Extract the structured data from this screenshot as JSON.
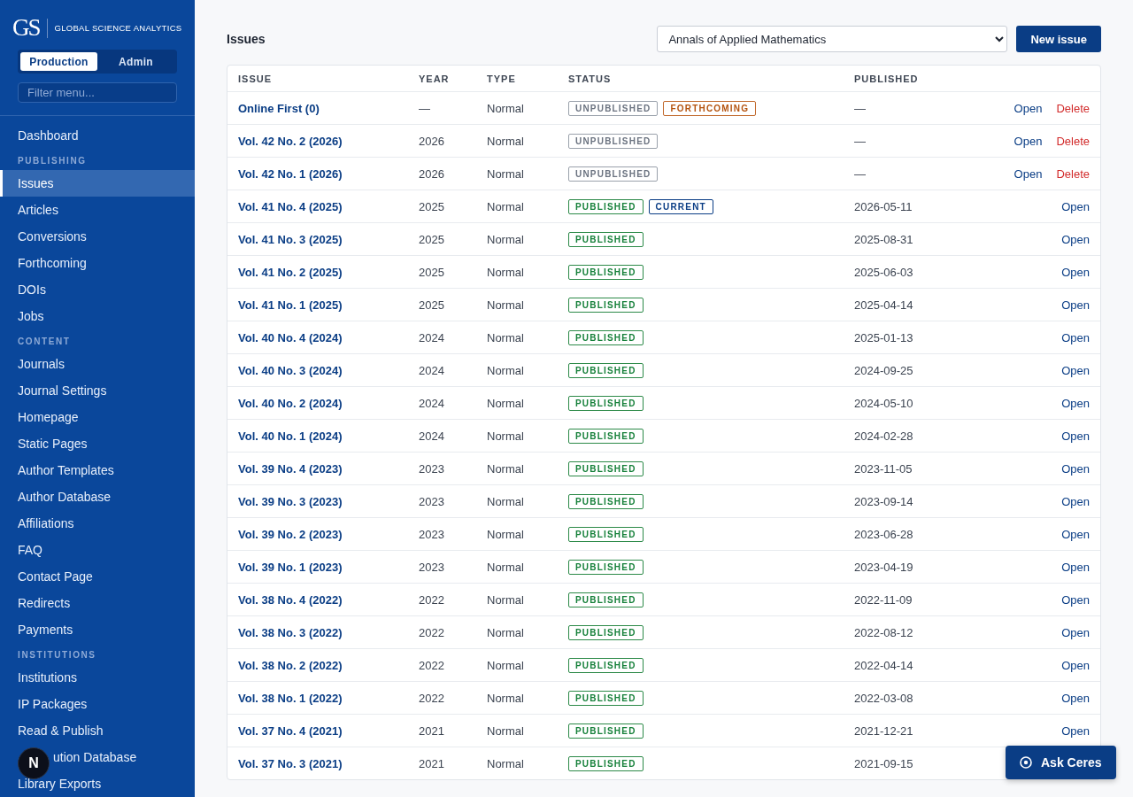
{
  "brand": {
    "mark": "GS",
    "name": "GLOBAL SCIENCE ANALYTICS"
  },
  "modes": [
    {
      "label": "Production",
      "selected": true
    },
    {
      "label": "Admin",
      "selected": false
    }
  ],
  "filter": {
    "placeholder": "Filter menu..."
  },
  "nav": [
    {
      "kind": "item",
      "label": "Dashboard",
      "selected": false
    },
    {
      "kind": "section",
      "label": "PUBLISHING"
    },
    {
      "kind": "item",
      "label": "Issues",
      "selected": true
    },
    {
      "kind": "item",
      "label": "Articles",
      "selected": false
    },
    {
      "kind": "item",
      "label": "Conversions",
      "selected": false
    },
    {
      "kind": "item",
      "label": "Forthcoming",
      "selected": false
    },
    {
      "kind": "item",
      "label": "DOIs",
      "selected": false
    },
    {
      "kind": "item",
      "label": "Jobs",
      "selected": false
    },
    {
      "kind": "section",
      "label": "CONTENT"
    },
    {
      "kind": "item",
      "label": "Journals",
      "selected": false
    },
    {
      "kind": "item",
      "label": "Journal Settings",
      "selected": false
    },
    {
      "kind": "item",
      "label": "Homepage",
      "selected": false
    },
    {
      "kind": "item",
      "label": "Static Pages",
      "selected": false
    },
    {
      "kind": "item",
      "label": "Author Templates",
      "selected": false
    },
    {
      "kind": "item",
      "label": "Author Database",
      "selected": false
    },
    {
      "kind": "item",
      "label": "Affiliations",
      "selected": false
    },
    {
      "kind": "item",
      "label": "FAQ",
      "selected": false
    },
    {
      "kind": "item",
      "label": "Contact Page",
      "selected": false
    },
    {
      "kind": "item",
      "label": "Redirects",
      "selected": false
    },
    {
      "kind": "item",
      "label": "Payments",
      "selected": false
    },
    {
      "kind": "section",
      "label": "INSTITUTIONS"
    },
    {
      "kind": "item",
      "label": "Institutions",
      "selected": false
    },
    {
      "kind": "item",
      "label": "IP Packages",
      "selected": false
    },
    {
      "kind": "item",
      "label": "Read & Publish",
      "selected": false
    },
    {
      "kind": "covered",
      "label": "ution Database",
      "selected": false
    },
    {
      "kind": "item",
      "label": "Library Exports",
      "selected": false
    }
  ],
  "dev_badge": "N",
  "page_title": "Issues",
  "journal_select": {
    "value": "Annals of Applied Mathematics"
  },
  "new_button": "New issue",
  "table": {
    "columns": [
      "ISSUE",
      "YEAR",
      "TYPE",
      "STATUS",
      "PUBLISHED"
    ],
    "rows": [
      {
        "issue": "Online First (0)",
        "year": "—",
        "type": "Normal",
        "badges": [
          {
            "kind": "unpublished",
            "label": "UNPUBLISHED"
          },
          {
            "kind": "forthcoming",
            "label": "FORTHCOMING"
          }
        ],
        "published": "—",
        "actions": [
          {
            "kind": "open",
            "label": "Open"
          },
          {
            "kind": "delete",
            "label": "Delete"
          }
        ]
      },
      {
        "issue": "Vol. 42 No. 2 (2026)",
        "year": "2026",
        "type": "Normal",
        "badges": [
          {
            "kind": "unpublished",
            "label": "UNPUBLISHED"
          }
        ],
        "published": "—",
        "actions": [
          {
            "kind": "open",
            "label": "Open"
          },
          {
            "kind": "delete",
            "label": "Delete"
          }
        ]
      },
      {
        "issue": "Vol. 42 No. 1 (2026)",
        "year": "2026",
        "type": "Normal",
        "badges": [
          {
            "kind": "unpublished",
            "label": "UNPUBLISHED"
          }
        ],
        "published": "—",
        "actions": [
          {
            "kind": "open",
            "label": "Open"
          },
          {
            "kind": "delete",
            "label": "Delete"
          }
        ]
      },
      {
        "issue": "Vol. 41 No. 4 (2025)",
        "year": "2025",
        "type": "Normal",
        "badges": [
          {
            "kind": "published",
            "label": "PUBLISHED"
          },
          {
            "kind": "current",
            "label": "CURRENT"
          }
        ],
        "published": "2026-05-11",
        "actions": [
          {
            "kind": "open",
            "label": "Open"
          }
        ]
      },
      {
        "issue": "Vol. 41 No. 3 (2025)",
        "year": "2025",
        "type": "Normal",
        "badges": [
          {
            "kind": "published",
            "label": "PUBLISHED"
          }
        ],
        "published": "2025-08-31",
        "actions": [
          {
            "kind": "open",
            "label": "Open"
          }
        ]
      },
      {
        "issue": "Vol. 41 No. 2 (2025)",
        "year": "2025",
        "type": "Normal",
        "badges": [
          {
            "kind": "published",
            "label": "PUBLISHED"
          }
        ],
        "published": "2025-06-03",
        "actions": [
          {
            "kind": "open",
            "label": "Open"
          }
        ]
      },
      {
        "issue": "Vol. 41 No. 1 (2025)",
        "year": "2025",
        "type": "Normal",
        "badges": [
          {
            "kind": "published",
            "label": "PUBLISHED"
          }
        ],
        "published": "2025-04-14",
        "actions": [
          {
            "kind": "open",
            "label": "Open"
          }
        ]
      },
      {
        "issue": "Vol. 40 No. 4 (2024)",
        "year": "2024",
        "type": "Normal",
        "badges": [
          {
            "kind": "published",
            "label": "PUBLISHED"
          }
        ],
        "published": "2025-01-13",
        "actions": [
          {
            "kind": "open",
            "label": "Open"
          }
        ]
      },
      {
        "issue": "Vol. 40 No. 3 (2024)",
        "year": "2024",
        "type": "Normal",
        "badges": [
          {
            "kind": "published",
            "label": "PUBLISHED"
          }
        ],
        "published": "2024-09-25",
        "actions": [
          {
            "kind": "open",
            "label": "Open"
          }
        ]
      },
      {
        "issue": "Vol. 40 No. 2 (2024)",
        "year": "2024",
        "type": "Normal",
        "badges": [
          {
            "kind": "published",
            "label": "PUBLISHED"
          }
        ],
        "published": "2024-05-10",
        "actions": [
          {
            "kind": "open",
            "label": "Open"
          }
        ]
      },
      {
        "issue": "Vol. 40 No. 1 (2024)",
        "year": "2024",
        "type": "Normal",
        "badges": [
          {
            "kind": "published",
            "label": "PUBLISHED"
          }
        ],
        "published": "2024-02-28",
        "actions": [
          {
            "kind": "open",
            "label": "Open"
          }
        ]
      },
      {
        "issue": "Vol. 39 No. 4 (2023)",
        "year": "2023",
        "type": "Normal",
        "badges": [
          {
            "kind": "published",
            "label": "PUBLISHED"
          }
        ],
        "published": "2023-11-05",
        "actions": [
          {
            "kind": "open",
            "label": "Open"
          }
        ]
      },
      {
        "issue": "Vol. 39 No. 3 (2023)",
        "year": "2023",
        "type": "Normal",
        "badges": [
          {
            "kind": "published",
            "label": "PUBLISHED"
          }
        ],
        "published": "2023-09-14",
        "actions": [
          {
            "kind": "open",
            "label": "Open"
          }
        ]
      },
      {
        "issue": "Vol. 39 No. 2 (2023)",
        "year": "2023",
        "type": "Normal",
        "badges": [
          {
            "kind": "published",
            "label": "PUBLISHED"
          }
        ],
        "published": "2023-06-28",
        "actions": [
          {
            "kind": "open",
            "label": "Open"
          }
        ]
      },
      {
        "issue": "Vol. 39 No. 1 (2023)",
        "year": "2023",
        "type": "Normal",
        "badges": [
          {
            "kind": "published",
            "label": "PUBLISHED"
          }
        ],
        "published": "2023-04-19",
        "actions": [
          {
            "kind": "open",
            "label": "Open"
          }
        ]
      },
      {
        "issue": "Vol. 38 No. 4 (2022)",
        "year": "2022",
        "type": "Normal",
        "badges": [
          {
            "kind": "published",
            "label": "PUBLISHED"
          }
        ],
        "published": "2022-11-09",
        "actions": [
          {
            "kind": "open",
            "label": "Open"
          }
        ]
      },
      {
        "issue": "Vol. 38 No. 3 (2022)",
        "year": "2022",
        "type": "Normal",
        "badges": [
          {
            "kind": "published",
            "label": "PUBLISHED"
          }
        ],
        "published": "2022-08-12",
        "actions": [
          {
            "kind": "open",
            "label": "Open"
          }
        ]
      },
      {
        "issue": "Vol. 38 No. 2 (2022)",
        "year": "2022",
        "type": "Normal",
        "badges": [
          {
            "kind": "published",
            "label": "PUBLISHED"
          }
        ],
        "published": "2022-04-14",
        "actions": [
          {
            "kind": "open",
            "label": "Open"
          }
        ]
      },
      {
        "issue": "Vol. 38 No. 1 (2022)",
        "year": "2022",
        "type": "Normal",
        "badges": [
          {
            "kind": "published",
            "label": "PUBLISHED"
          }
        ],
        "published": "2022-03-08",
        "actions": [
          {
            "kind": "open",
            "label": "Open"
          }
        ]
      },
      {
        "issue": "Vol. 37 No. 4 (2021)",
        "year": "2021",
        "type": "Normal",
        "badges": [
          {
            "kind": "published",
            "label": "PUBLISHED"
          }
        ],
        "published": "2021-12-21",
        "actions": [
          {
            "kind": "open",
            "label": "Open"
          }
        ]
      },
      {
        "issue": "Vol. 37 No. 3 (2021)",
        "year": "2021",
        "type": "Normal",
        "badges": [
          {
            "kind": "published",
            "label": "PUBLISHED"
          }
        ],
        "published": "2021-09-15"
      }
    ]
  },
  "assistant_button": "Ask Ceres"
}
